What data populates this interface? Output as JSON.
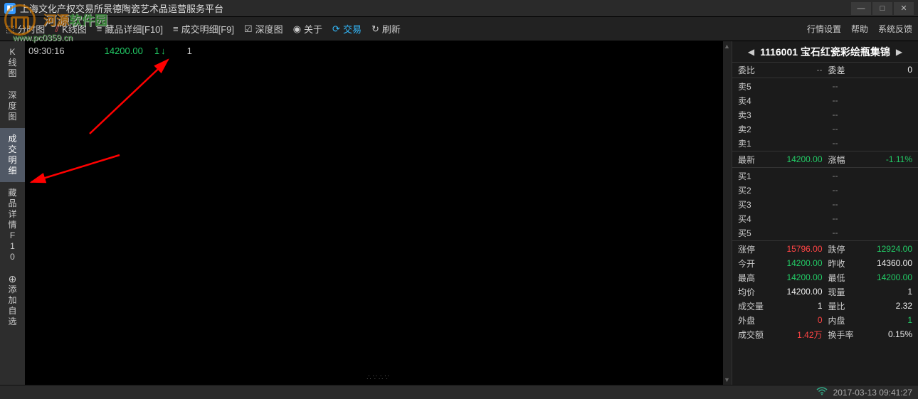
{
  "window": {
    "title": "上海文化产权交易所景德陶瓷艺术品运营服务平台"
  },
  "watermark": {
    "brand1": "河源",
    "brand2": "软件园",
    "url": "www.pc0359.cn"
  },
  "toolbar": {
    "items": [
      {
        "label": "分时图",
        "icon": "chart"
      },
      {
        "label": "K线图",
        "icon": "kline"
      },
      {
        "label": "藏品详细[F10]",
        "icon": "list"
      },
      {
        "label": "成交明细[F9]",
        "icon": "list"
      },
      {
        "label": "深度图",
        "icon": "depth"
      },
      {
        "label": "关于",
        "icon": "about"
      },
      {
        "label": "交易",
        "icon": "trade",
        "active": true
      },
      {
        "label": "刷新",
        "icon": "refresh"
      }
    ],
    "right": [
      {
        "label": "行情设置"
      },
      {
        "label": "帮助"
      },
      {
        "label": "系统反馈"
      }
    ]
  },
  "sidebar": {
    "items": [
      {
        "label": "K线图",
        "name": "sb-kline"
      },
      {
        "label": "深度图",
        "name": "sb-depth"
      },
      {
        "label": "成交明细",
        "name": "sb-trade-detail",
        "active": true
      },
      {
        "label": "藏品详情F10",
        "name": "sb-item-detail"
      },
      {
        "label": "添加自选",
        "name": "sb-add-fav",
        "plus": true
      }
    ]
  },
  "trade_row": {
    "time": "09:30:16",
    "price": "14200.00",
    "vol": "1",
    "dir": "↓",
    "count": "1"
  },
  "quote": {
    "code": "1116001",
    "name": "宝石红瓷彩绘瓶集锦",
    "weibi_label": "委比",
    "weibi_val": "--",
    "weicha_label": "委差",
    "weicha_val": "0",
    "asks": [
      {
        "label": "卖5",
        "price": "--",
        "vol": ""
      },
      {
        "label": "卖4",
        "price": "--",
        "vol": ""
      },
      {
        "label": "卖3",
        "price": "--",
        "vol": ""
      },
      {
        "label": "卖2",
        "price": "--",
        "vol": ""
      },
      {
        "label": "卖1",
        "price": "--",
        "vol": ""
      }
    ],
    "latest_label": "最新",
    "latest_price": "14200.00",
    "change_label": "涨幅",
    "change_val": "-1.11%",
    "bids": [
      {
        "label": "买1",
        "price": "--",
        "vol": ""
      },
      {
        "label": "买2",
        "price": "--",
        "vol": ""
      },
      {
        "label": "买3",
        "price": "--",
        "vol": ""
      },
      {
        "label": "买4",
        "price": "--",
        "vol": ""
      },
      {
        "label": "买5",
        "price": "--",
        "vol": ""
      }
    ],
    "stats": [
      {
        "l1": "涨停",
        "v1": "15796.00",
        "c1": "c-red",
        "l2": "跌停",
        "v2": "12924.00",
        "c2": "c-green"
      },
      {
        "l1": "今开",
        "v1": "14200.00",
        "c1": "c-green",
        "l2": "昨收",
        "v2": "14360.00",
        "c2": "c-white"
      },
      {
        "l1": "最高",
        "v1": "14200.00",
        "c1": "c-green",
        "l2": "最低",
        "v2": "14200.00",
        "c2": "c-green"
      },
      {
        "l1": "均价",
        "v1": "14200.00",
        "c1": "c-white",
        "l2": "现量",
        "v2": "1",
        "c2": "c-white"
      },
      {
        "l1": "成交量",
        "v1": "1",
        "c1": "c-white",
        "l2": "量比",
        "v2": "2.32",
        "c2": "c-white"
      },
      {
        "l1": "外盘",
        "v1": "0",
        "c1": "c-red",
        "l2": "内盘",
        "v2": "1",
        "c2": "c-green"
      },
      {
        "l1": "成交额",
        "v1": "1.42万",
        "c1": "c-red",
        "l2": "换手率",
        "v2": "0.15%",
        "c2": "c-white"
      }
    ]
  },
  "statusbar": {
    "datetime": "2017-03-13 09:41:27"
  }
}
